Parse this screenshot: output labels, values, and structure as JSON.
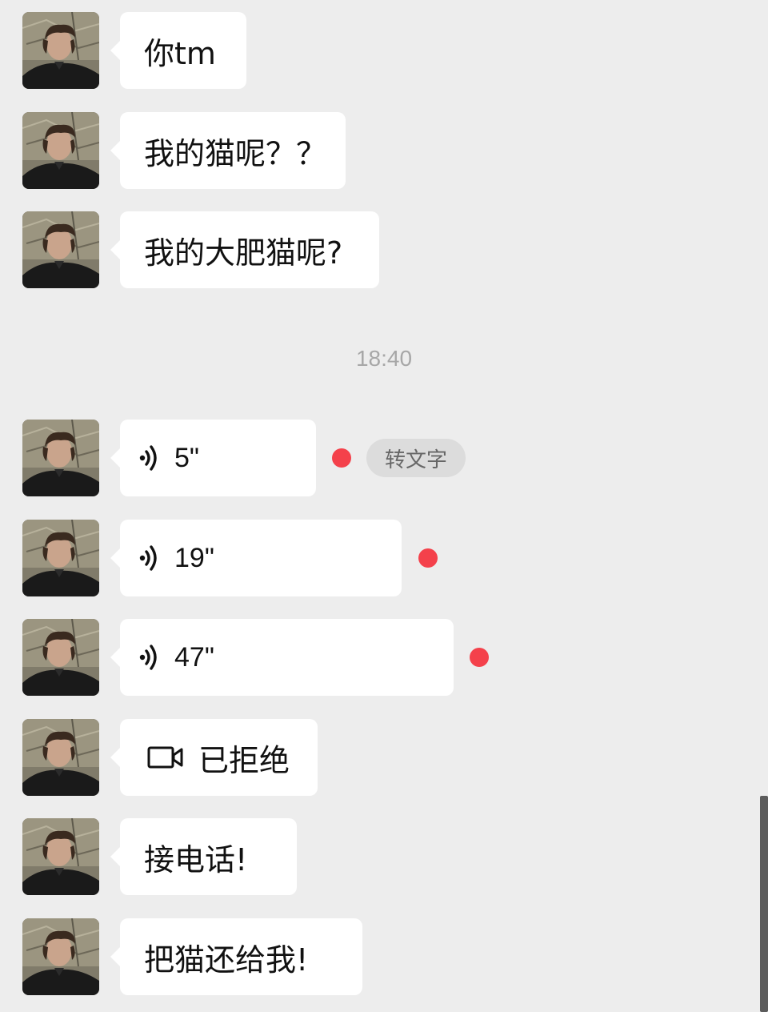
{
  "chat": {
    "timestamp": "18:40",
    "messages": [
      {
        "type": "text",
        "text": "你tm"
      },
      {
        "type": "text",
        "text": "我的猫呢？？"
      },
      {
        "type": "text",
        "text": "我的大肥猫呢?"
      },
      {
        "type": "voice",
        "duration": "5\"",
        "unread": true,
        "to_text_label": "转文字"
      },
      {
        "type": "voice",
        "duration": "19\"",
        "unread": true
      },
      {
        "type": "voice",
        "duration": "47\"",
        "unread": true
      },
      {
        "type": "call",
        "icon": "video-camera-icon",
        "text": "已拒绝"
      },
      {
        "type": "text",
        "text": "接电话!"
      },
      {
        "type": "text",
        "text": "把猫还给我!"
      }
    ]
  },
  "colors": {
    "background": "#ededed",
    "bubble": "#ffffff",
    "unread_dot": "#f4414b",
    "timestamp": "#a7a7a7"
  }
}
